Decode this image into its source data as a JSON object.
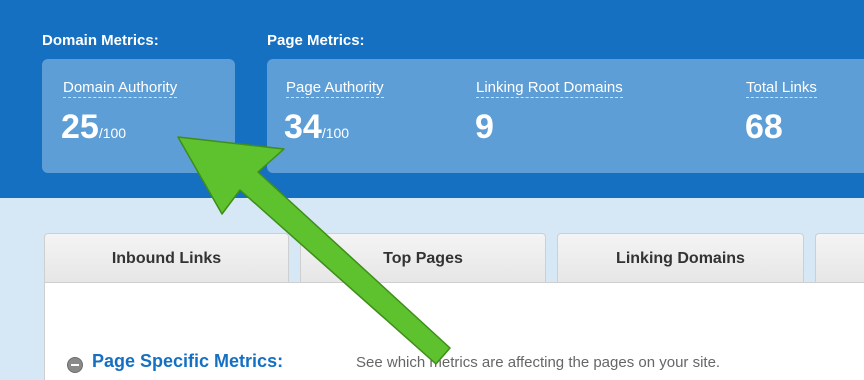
{
  "domain_metrics": {
    "heading": "Domain Metrics:",
    "domain_authority": {
      "label": "Domain Authority",
      "value": "25",
      "suffix": "/100"
    }
  },
  "page_metrics": {
    "heading": "Page Metrics:",
    "page_authority": {
      "label": "Page Authority",
      "value": "34",
      "suffix": "/100"
    },
    "linking_root_domains": {
      "label": "Linking Root Domains",
      "value": "9"
    },
    "total_links": {
      "label": "Total Links",
      "value": "68"
    }
  },
  "tabs": [
    {
      "label": "Inbound Links"
    },
    {
      "label": "Top Pages"
    },
    {
      "label": "Linking Domains"
    }
  ],
  "section": {
    "title": "Page Specific Metrics:",
    "description": "See which metrics are affecting the pages on your site."
  },
  "colors": {
    "band": "#1670c2",
    "metric_box": "#5d9ed6",
    "annotation_arrow": "#5ec12e"
  },
  "annotation": {
    "icon": "green-arrow"
  }
}
